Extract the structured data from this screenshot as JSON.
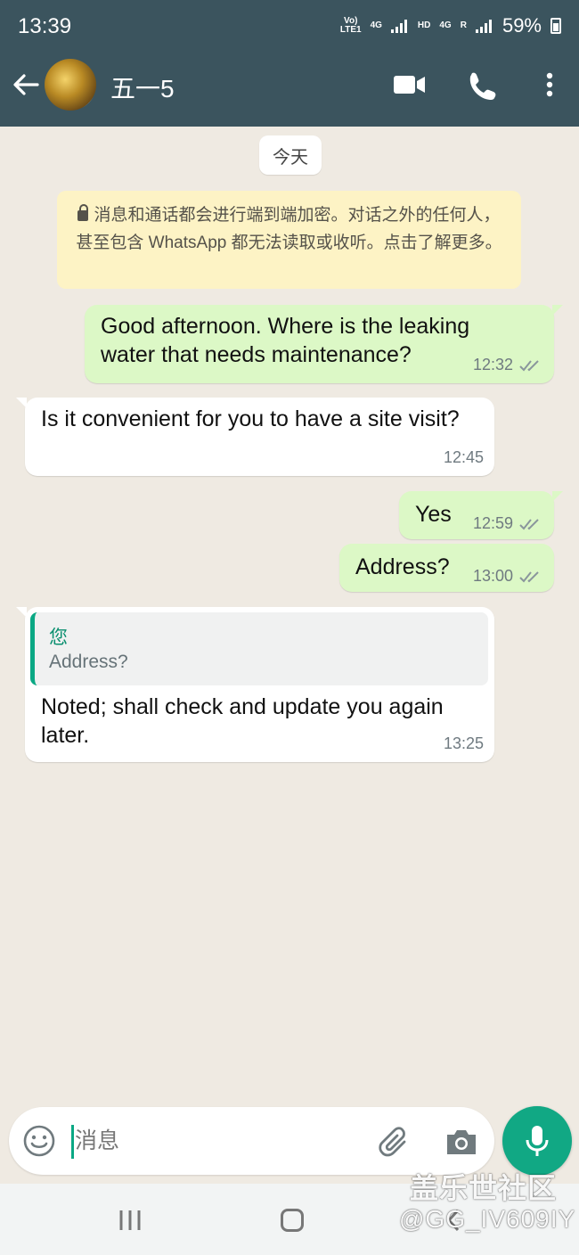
{
  "status_bar": {
    "time": "13:39",
    "sim1_top": "Vo)",
    "sim1_bottom": "LTE1",
    "net1": "4G",
    "hd": "HD",
    "net2": "4G",
    "roaming": "R",
    "battery": "59%"
  },
  "header": {
    "contact_name": "五一5",
    "icons": [
      "back-arrow-icon",
      "video-call-icon",
      "phone-icon",
      "more-options-icon"
    ]
  },
  "chat": {
    "date_chip": "今天",
    "encryption_notice": "消息和通话都会进行端到端加密。对话之外的任何人，甚至包含 WhatsApp 都无法读取或收听。点击了解更多。",
    "messages": [
      {
        "direction": "outgoing",
        "text": "Good afternoon. Where is the leaking water that needs maintenance?",
        "time": "12:32",
        "status": "read"
      },
      {
        "direction": "incoming",
        "text": "Is it convenient for you to have a site visit?",
        "time": "12:45"
      },
      {
        "direction": "outgoing",
        "text": "Yes",
        "time": "12:59",
        "status": "read"
      },
      {
        "direction": "outgoing",
        "text": "Address?",
        "time": "13:00",
        "status": "read"
      },
      {
        "direction": "incoming",
        "text": "Noted; shall check and update you again later.",
        "time": "13:25",
        "reply_to": {
          "author": "您",
          "text": "Address?"
        }
      }
    ]
  },
  "input_bar": {
    "placeholder": "消息",
    "icons": [
      "emoji-icon",
      "attach-icon",
      "camera-icon",
      "mic-icon"
    ]
  },
  "watermark": {
    "line1": "盖乐世社区",
    "line2": "@GG_IV609IY"
  },
  "colors": {
    "header": "#3b545e",
    "outgoing_bubble": "#dcf8c6",
    "incoming_bubble": "#ffffff",
    "accent": "#11a884",
    "chat_background": "#efeae2",
    "notice_background": "#fdf3c5"
  }
}
